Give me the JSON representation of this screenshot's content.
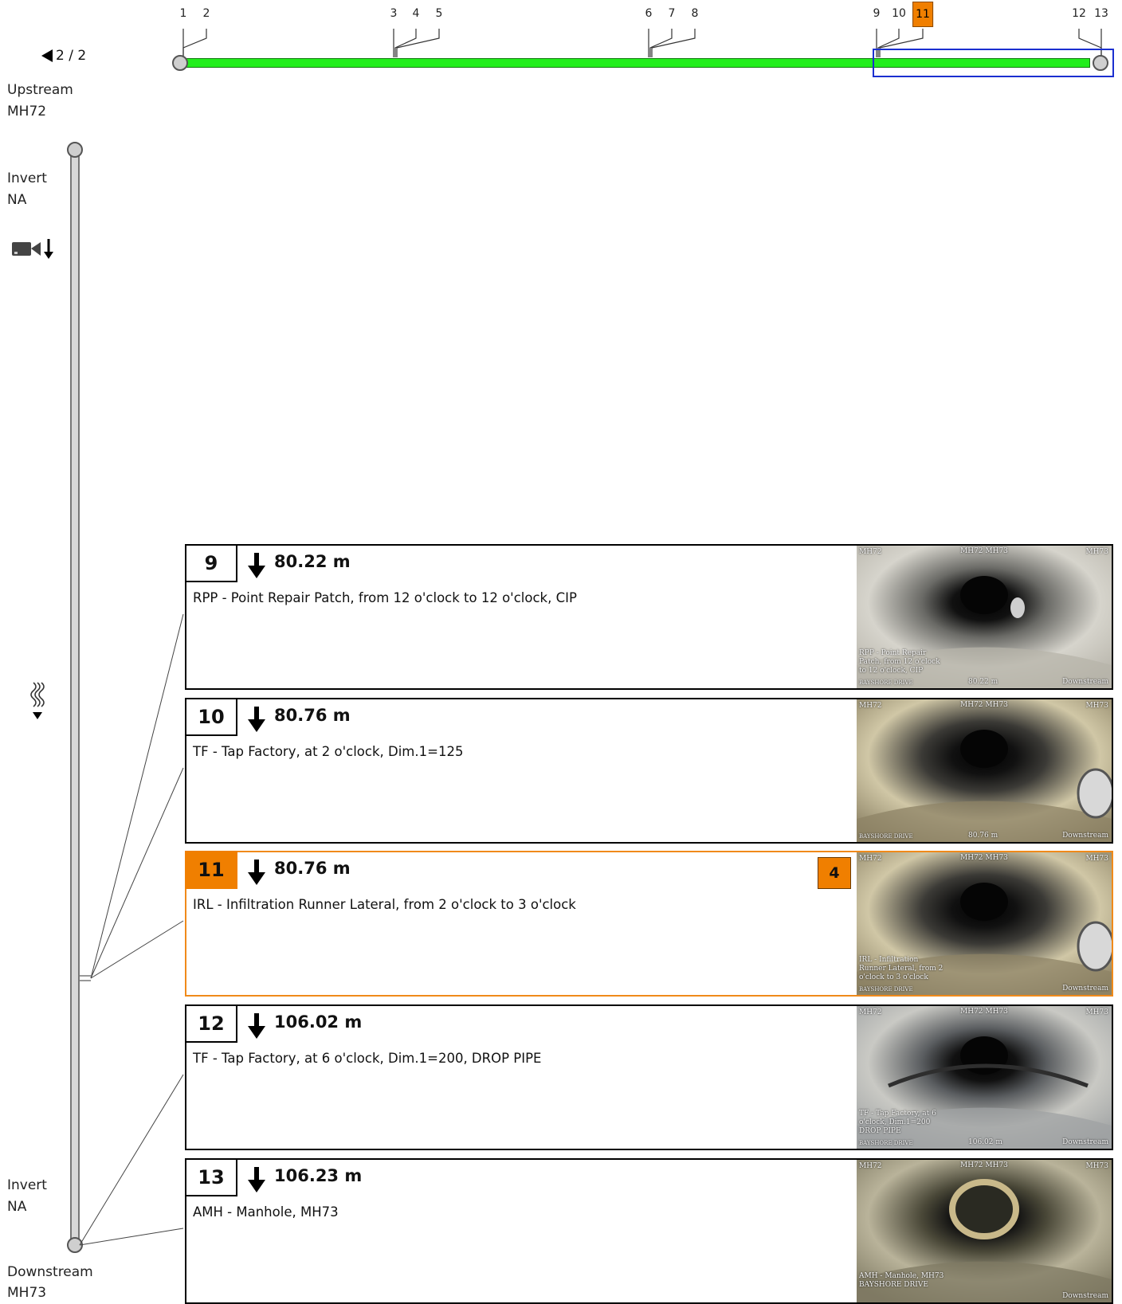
{
  "overview": {
    "ticks": [
      "1",
      "2",
      "3",
      "4",
      "5",
      "6",
      "7",
      "8",
      "9",
      "10",
      "11",
      "12",
      "13"
    ],
    "active_tick": "11",
    "pager": "2 / 2"
  },
  "labels": {
    "upstream": "Upstream",
    "upstream_id": "MH72",
    "invert_top": "Invert",
    "invert_top_val": "NA",
    "invert_bottom": "Invert",
    "invert_bottom_val": "NA",
    "downstream": "Downstream",
    "downstream_id": "MH73"
  },
  "observations": [
    {
      "num": "9",
      "distance": "80.22 m",
      "description": "RPP - Point Repair Patch, from 12 o'clock to 12 o'clock, CIP",
      "photo": {
        "top_left": "MH72",
        "top_mid": "MH72 MH73",
        "top_right": "MH73",
        "caption": "RPP - Point Repair Patch, from 12 o'clock to 12 o'clock, CIP",
        "dist": "80.22 m",
        "dir": "Downstream",
        "street": "BAYSHORE DRIVE"
      }
    },
    {
      "num": "10",
      "distance": "80.76 m",
      "description": "TF - Tap Factory, at 2 o'clock, Dim.1=125",
      "photo": {
        "top_left": "MH72",
        "top_mid": "MH72 MH73",
        "top_right": "MH73",
        "caption": "",
        "dist": "80.76 m",
        "dir": "Downstream",
        "street": "BAYSHORE DRIVE"
      }
    },
    {
      "num": "11",
      "distance": "80.76 m",
      "description": "IRL - Infiltration Runner Lateral, from 2 o'clock to 3 o'clock",
      "count": "4",
      "selected": true,
      "photo": {
        "top_left": "MH72",
        "top_mid": "MH72 MH73",
        "top_right": "MH73",
        "caption": "IRL - Infiltration Runner Lateral, from 2 o'clock to 3 o'clock",
        "dist": "",
        "dir": "Downstream",
        "street": "BAYSHORE DRIVE"
      }
    },
    {
      "num": "12",
      "distance": "106.02 m",
      "description": "TF - Tap Factory, at 6 o'clock, Dim.1=200, DROP PIPE",
      "photo": {
        "top_left": "MH72",
        "top_mid": "MH72 MH73",
        "top_right": "MH73",
        "caption": "TF - Tap Factory, at 6 o'clock, Dim.1=200 DROP PIPE",
        "dist": "106.02 m",
        "dir": "Downstream",
        "street": "BAYSHORE DRIVE"
      }
    },
    {
      "num": "13",
      "distance": "106.23 m",
      "description": "AMH - Manhole, MH73",
      "photo": {
        "top_left": "MH72",
        "top_mid": "MH72 MH73",
        "top_right": "MH73",
        "caption": "AMH - Manhole, MH73 BAYSHORE DRIVE",
        "dist": "",
        "dir": "Downstream",
        "street": ""
      }
    }
  ],
  "colors": {
    "pipe_fill": "#22ee1c",
    "selected_accent": "#f07f00",
    "viewport_outline": "#1b2fd0"
  },
  "icons": {
    "camera": "camera-icon",
    "direction": "arrow-down-icon",
    "flow": "flow-wave-icon",
    "pager_prev": "triangle-left-icon"
  }
}
